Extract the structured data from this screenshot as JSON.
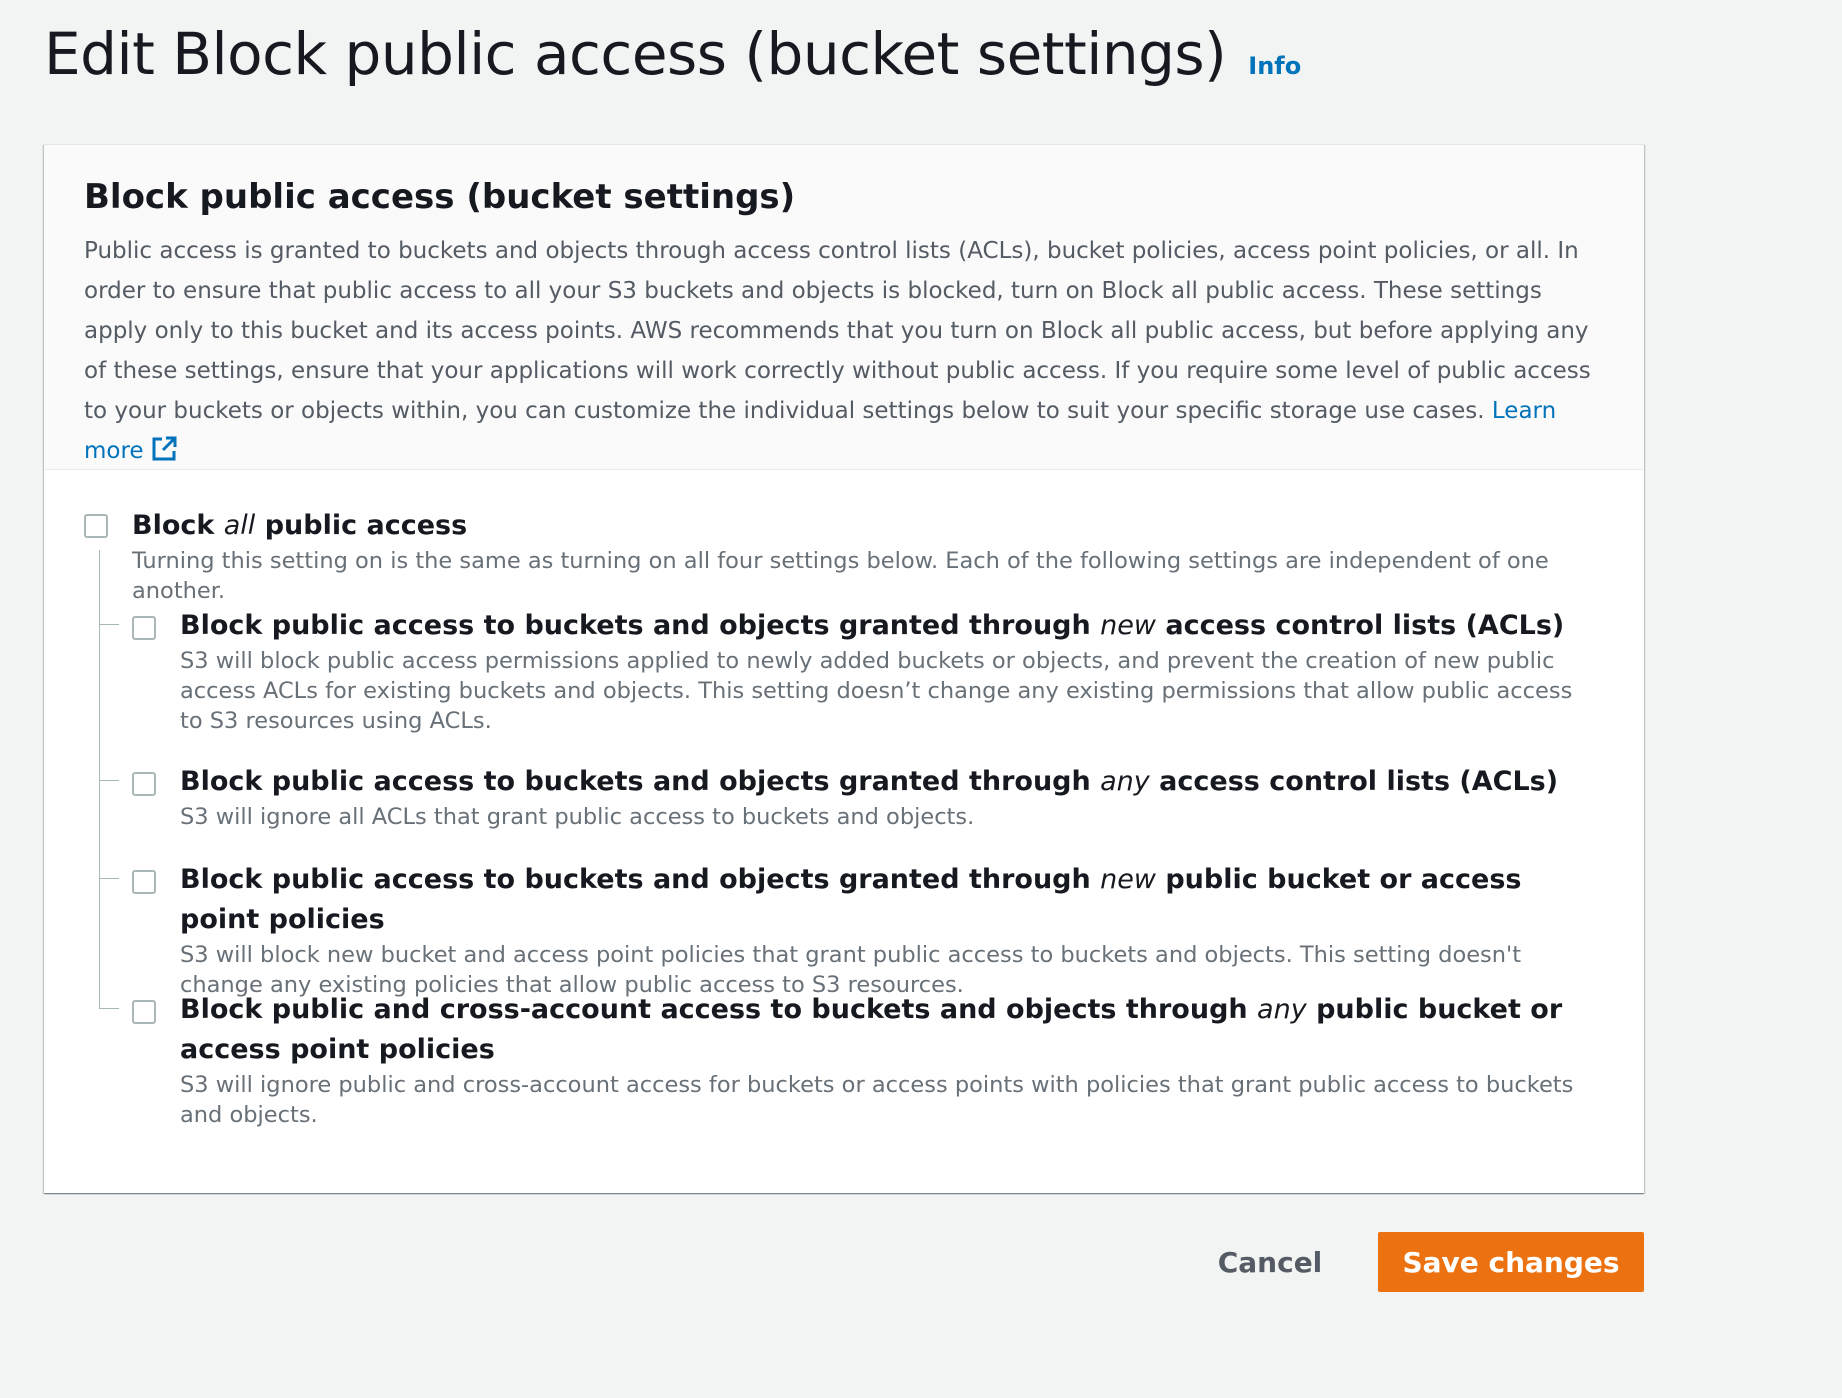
{
  "header": {
    "title": "Edit Block public access (bucket settings)",
    "info_label": "Info"
  },
  "panel": {
    "title": "Block public access (bucket settings)",
    "description": "Public access is granted to buckets and objects through access control lists (ACLs), bucket policies, access point policies, or all. In order to ensure that public access to all your S3 buckets and objects is blocked, turn on Block all public access. These settings apply only to this bucket and its access points. AWS recommends that you turn on Block all public access, but before applying any of these settings, ensure that your applications will work correctly without public access. If you require some level of public access to your buckets or objects within, you can customize the individual settings below to suit your specific storage use cases.",
    "learn_more": "Learn more"
  },
  "block_all": {
    "title_pre": "Block ",
    "title_em": "all",
    "title_post": " public access",
    "description": "Turning this setting on is the same as turning on all four settings below. Each of the following settings are independent of one another.",
    "checked": false
  },
  "options": [
    {
      "title_pre": "Block public access to buckets and objects granted through ",
      "title_em": "new",
      "title_post": " access control lists (ACLs)",
      "description": "S3 will block public access permissions applied to newly added buckets or objects, and prevent the creation of new public access ACLs for existing buckets and objects. This setting doesn’t change any existing permissions that allow public access to S3 resources using ACLs.",
      "checked": false
    },
    {
      "title_pre": "Block public access to buckets and objects granted through ",
      "title_em": "any",
      "title_post": " access control lists (ACLs)",
      "description": "S3 will ignore all ACLs that grant public access to buckets and objects.",
      "checked": false
    },
    {
      "title_pre": "Block public access to buckets and objects granted through ",
      "title_em": "new",
      "title_post": " public bucket or access point policies",
      "description": "S3 will block new bucket and access point policies that grant public access to buckets and objects. This setting doesn't change any existing policies that allow public access to S3 resources.",
      "checked": false
    },
    {
      "title_pre": "Block public and cross-account access to buckets and objects through ",
      "title_em": "any",
      "title_post": " public bucket or access point policies",
      "description": "S3 will ignore public and cross-account access for buckets or access points with policies that grant public access to buckets and objects.",
      "checked": false
    }
  ],
  "actions": {
    "cancel_label": "Cancel",
    "save_label": "Save changes"
  },
  "colors": {
    "primary_button": "#ec7211",
    "link": "#0073bb",
    "background": "#f2f3f3"
  }
}
